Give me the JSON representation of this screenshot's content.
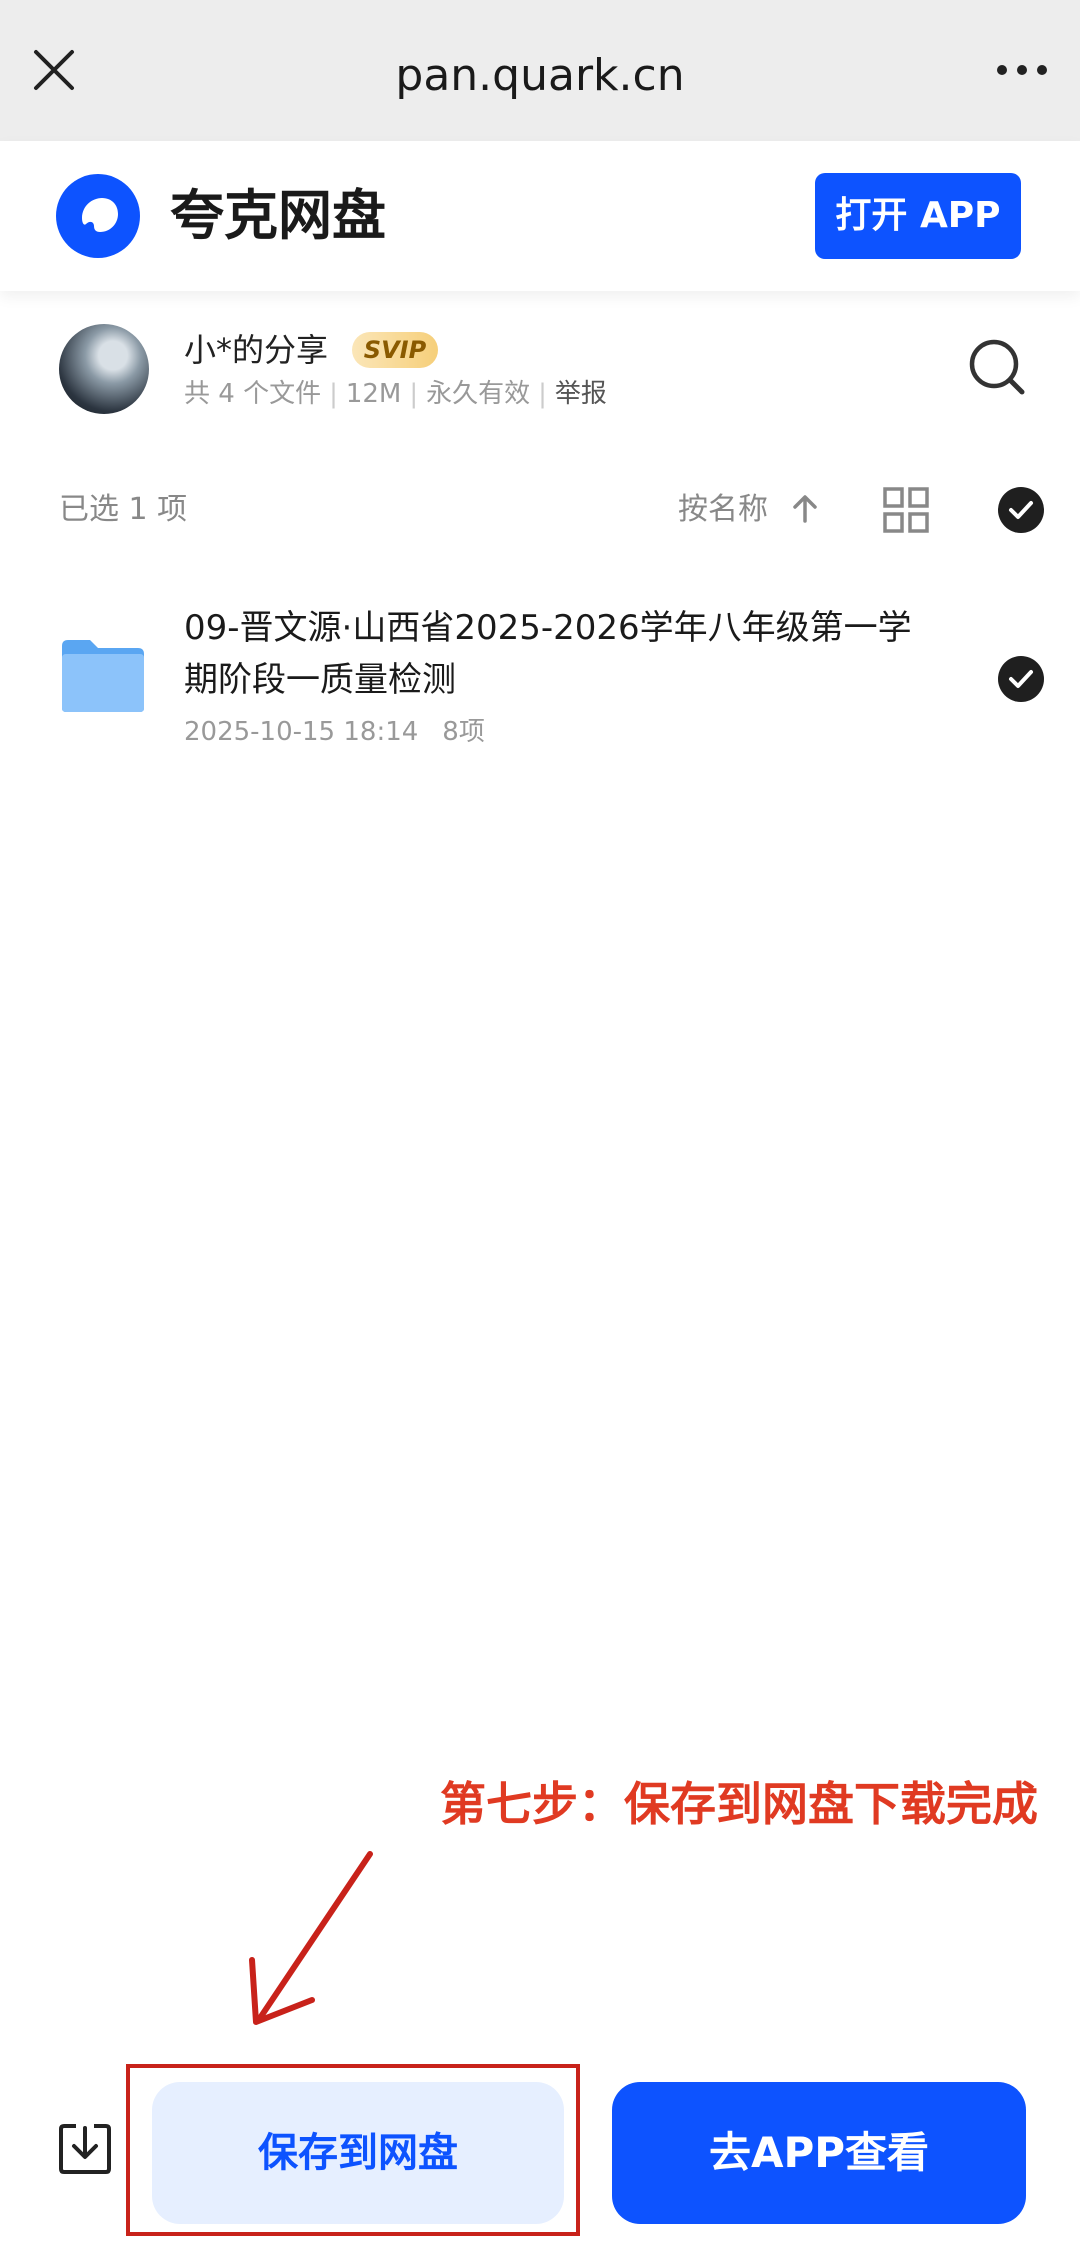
{
  "browser": {
    "url": "pan.quark.cn",
    "close_icon": "close-icon",
    "more_icon": "more-horizontal-icon"
  },
  "header": {
    "brand": "夸克网盘",
    "open_app_label": "打开 APP",
    "brand_color": "#0d53ff"
  },
  "share": {
    "owner": "小*的分享",
    "badge": "SVIP",
    "file_count": "共 4 个文件",
    "size": "12M",
    "validity": "永久有效",
    "report": "举报"
  },
  "toolbar": {
    "selected": "已选 1 项",
    "sort_label": "按名称"
  },
  "files": [
    {
      "name": "09-晋文源·山西省2025-2026学年八年级第一学期阶段一质量检测",
      "date": "2025-10-15 18:14",
      "count": "8项",
      "selected": true
    }
  ],
  "annotation": {
    "text": "第七步：保存到网盘下载完成",
    "color": "#e03a22"
  },
  "bottom": {
    "save_label": "保存到网盘",
    "goapp_label": "去APP查看"
  }
}
